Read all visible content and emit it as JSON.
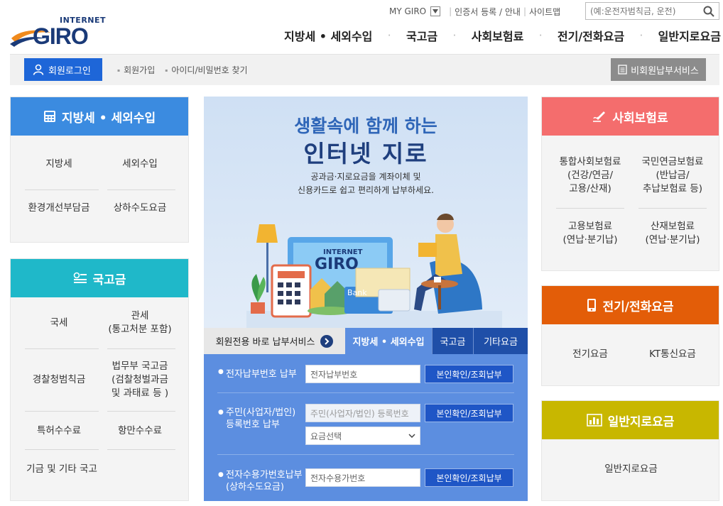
{
  "header": {
    "logo_small": "INTERNET",
    "logo_big": "GIRO",
    "top_links": [
      "MY GIRO",
      "인증서 등록 / 안내",
      "사이트맵"
    ],
    "search_placeholder": "(예:운전자범칙금, 운전)",
    "gnb": [
      "지방세 • 세외수입",
      "국고금",
      "사회보험료",
      "전기/전화요금",
      "일반지로요금"
    ]
  },
  "loginbar": {
    "login_label": "회원로그인",
    "links": [
      "회원가입",
      "아이디/비밀번호 찾기"
    ],
    "nonmember_label": "비회원납부서비스"
  },
  "left": {
    "local_tax": {
      "title": "지방세 • 세외수입",
      "color": "#3b8be0",
      "items": [
        "지방세",
        "세외수입",
        "환경개선부담금",
        "상하수도요금"
      ]
    },
    "national": {
      "title": "국고금",
      "color": "#1fb8c9",
      "items": [
        "국세",
        "관세\n(통고처분 포함)",
        "경찰청범칙금",
        "법무부 국고금\n(검찰청벌과금\n및 과태료 등 )",
        "특허수수료",
        "항만수수료",
        "기금 및 기타 국고"
      ]
    }
  },
  "hero": {
    "title1": "생활속에 함께 하는",
    "title2": "인터넷 지로",
    "desc1": "공과금·지로요금을 계좌이체 및",
    "desc2": "신용카드로 쉽고 편리하게 납부하세요.",
    "screen_small": "INTERNET",
    "screen_big": "GIRO",
    "bank": "Bank"
  },
  "tabs": {
    "member_service": "회원전용 바로 납부서비스",
    "items": [
      "지방세 • 세외수입",
      "국고금",
      "기타요금"
    ]
  },
  "pay": {
    "rows": [
      {
        "label": "전자납부번호 납부",
        "input": "전자납부번호",
        "button": "본인확인/조회납부"
      },
      {
        "label": "주민(사업자/법인)\n등록번호 납부",
        "input": "주민(사업자/법인) 등록번호",
        "select": "요금선택",
        "button": "본인확인/조회납부"
      },
      {
        "label": "전자수용가번호납부\n(상하수도요금)",
        "input": "전자수용가번호",
        "button": "본인확인/조회납부"
      }
    ]
  },
  "right": {
    "social": {
      "title": "사회보험료",
      "color": "#f46d6d",
      "items": [
        "통합사회보험료\n(건강/연금/\n고용/산재)",
        "국민연금보험료\n(반납금/\n추납보험료 등)",
        "고용보험료\n(연납·분기납)",
        "산재보험료\n(연납·분기납)"
      ]
    },
    "utility": {
      "title": "전기/전화요금",
      "color": "#e35d08",
      "items": [
        "전기요금",
        "KT통신요금"
      ]
    },
    "general": {
      "title": "일반지로요금",
      "color": "#c8b700",
      "items": [
        "일반지로요금"
      ]
    }
  }
}
